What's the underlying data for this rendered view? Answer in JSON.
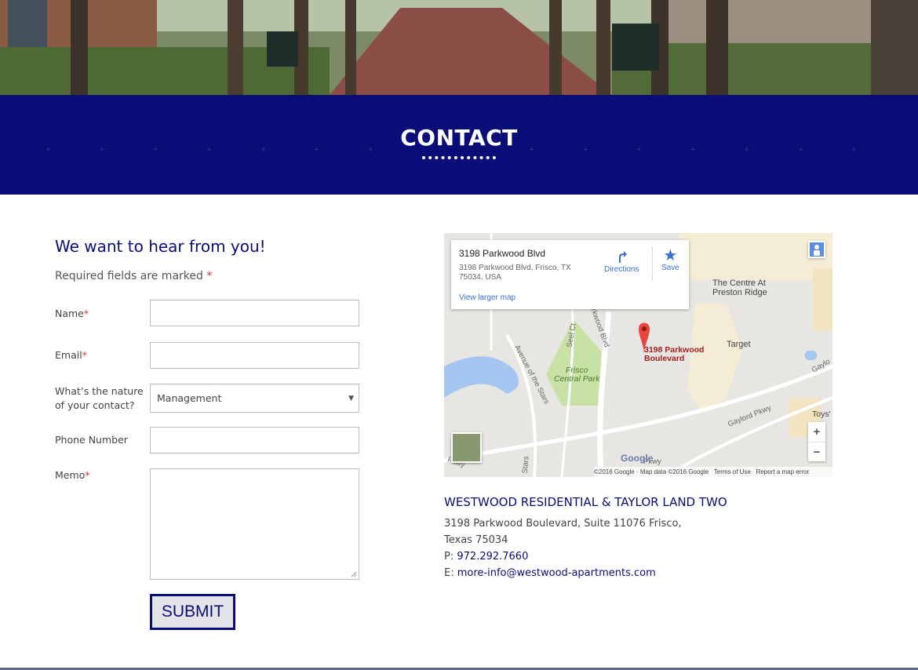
{
  "banner": {
    "title": "CONTACT"
  },
  "form": {
    "heading": "We want to hear from you!",
    "required_note": "Required fields are marked",
    "required_mark": "*",
    "fields": {
      "name_label": "Name",
      "email_label": "Email",
      "nature_label_line1": "What’s the nature",
      "nature_label_line2": "of your contact?",
      "nature_value": "Management",
      "phone_label": "Phone Number",
      "memo_label": "Memo"
    },
    "submit_label": "SUBMIT"
  },
  "map": {
    "place_title": "3198 Parkwood Blvd",
    "place_address_line1": "3198 Parkwood Blvd, Frisco, TX",
    "place_address_line2": "75034, USA",
    "larger_map_link": "View larger map",
    "directions_label": "Directions",
    "save_label": "Save",
    "marker_label_line1": "3198 Parkwood",
    "marker_label_line2": "Boulevard",
    "poi_centre_line1": "The Centre At",
    "poi_centre_line2": "Preston Ridge",
    "poi_target": "Target",
    "park_line1": "Frisco",
    "park_line2": "Central Park",
    "street_avenue": "Avenue of the Stars",
    "street_parkwood": "Parkwood Blvd",
    "street_seel": "Seel Ct",
    "street_gaylord": "Gaylord Pkwy",
    "street_gaylord2": "Gaylo",
    "street_toys": "Toys'",
    "street_stars": "Stars",
    "street_pkwy": "Pkwy",
    "street_pkwy2": "Pkwy",
    "logo": "Google",
    "attribution": "©2016 Google · Map data ©2016 Google",
    "terms": "Terms of Use",
    "report": "Report a map error",
    "zoom_in": "+",
    "zoom_out": "−"
  },
  "contact": {
    "company": "WESTWOOD RESIDENTIAL & TAYLOR LAND TWO",
    "address_line1": "3198 Parkwood Boulevard, Suite 11076 Frisco,",
    "address_line2": "Texas 75034",
    "phone_prefix": "P:",
    "phone": "972.292.7660",
    "email_prefix": "E:",
    "email": "more-info@westwood-apartments.com"
  },
  "colors": {
    "brand_navy": "#0a0d78",
    "required_red": "#d9302c",
    "map_link_blue": "#3a6fd8"
  }
}
